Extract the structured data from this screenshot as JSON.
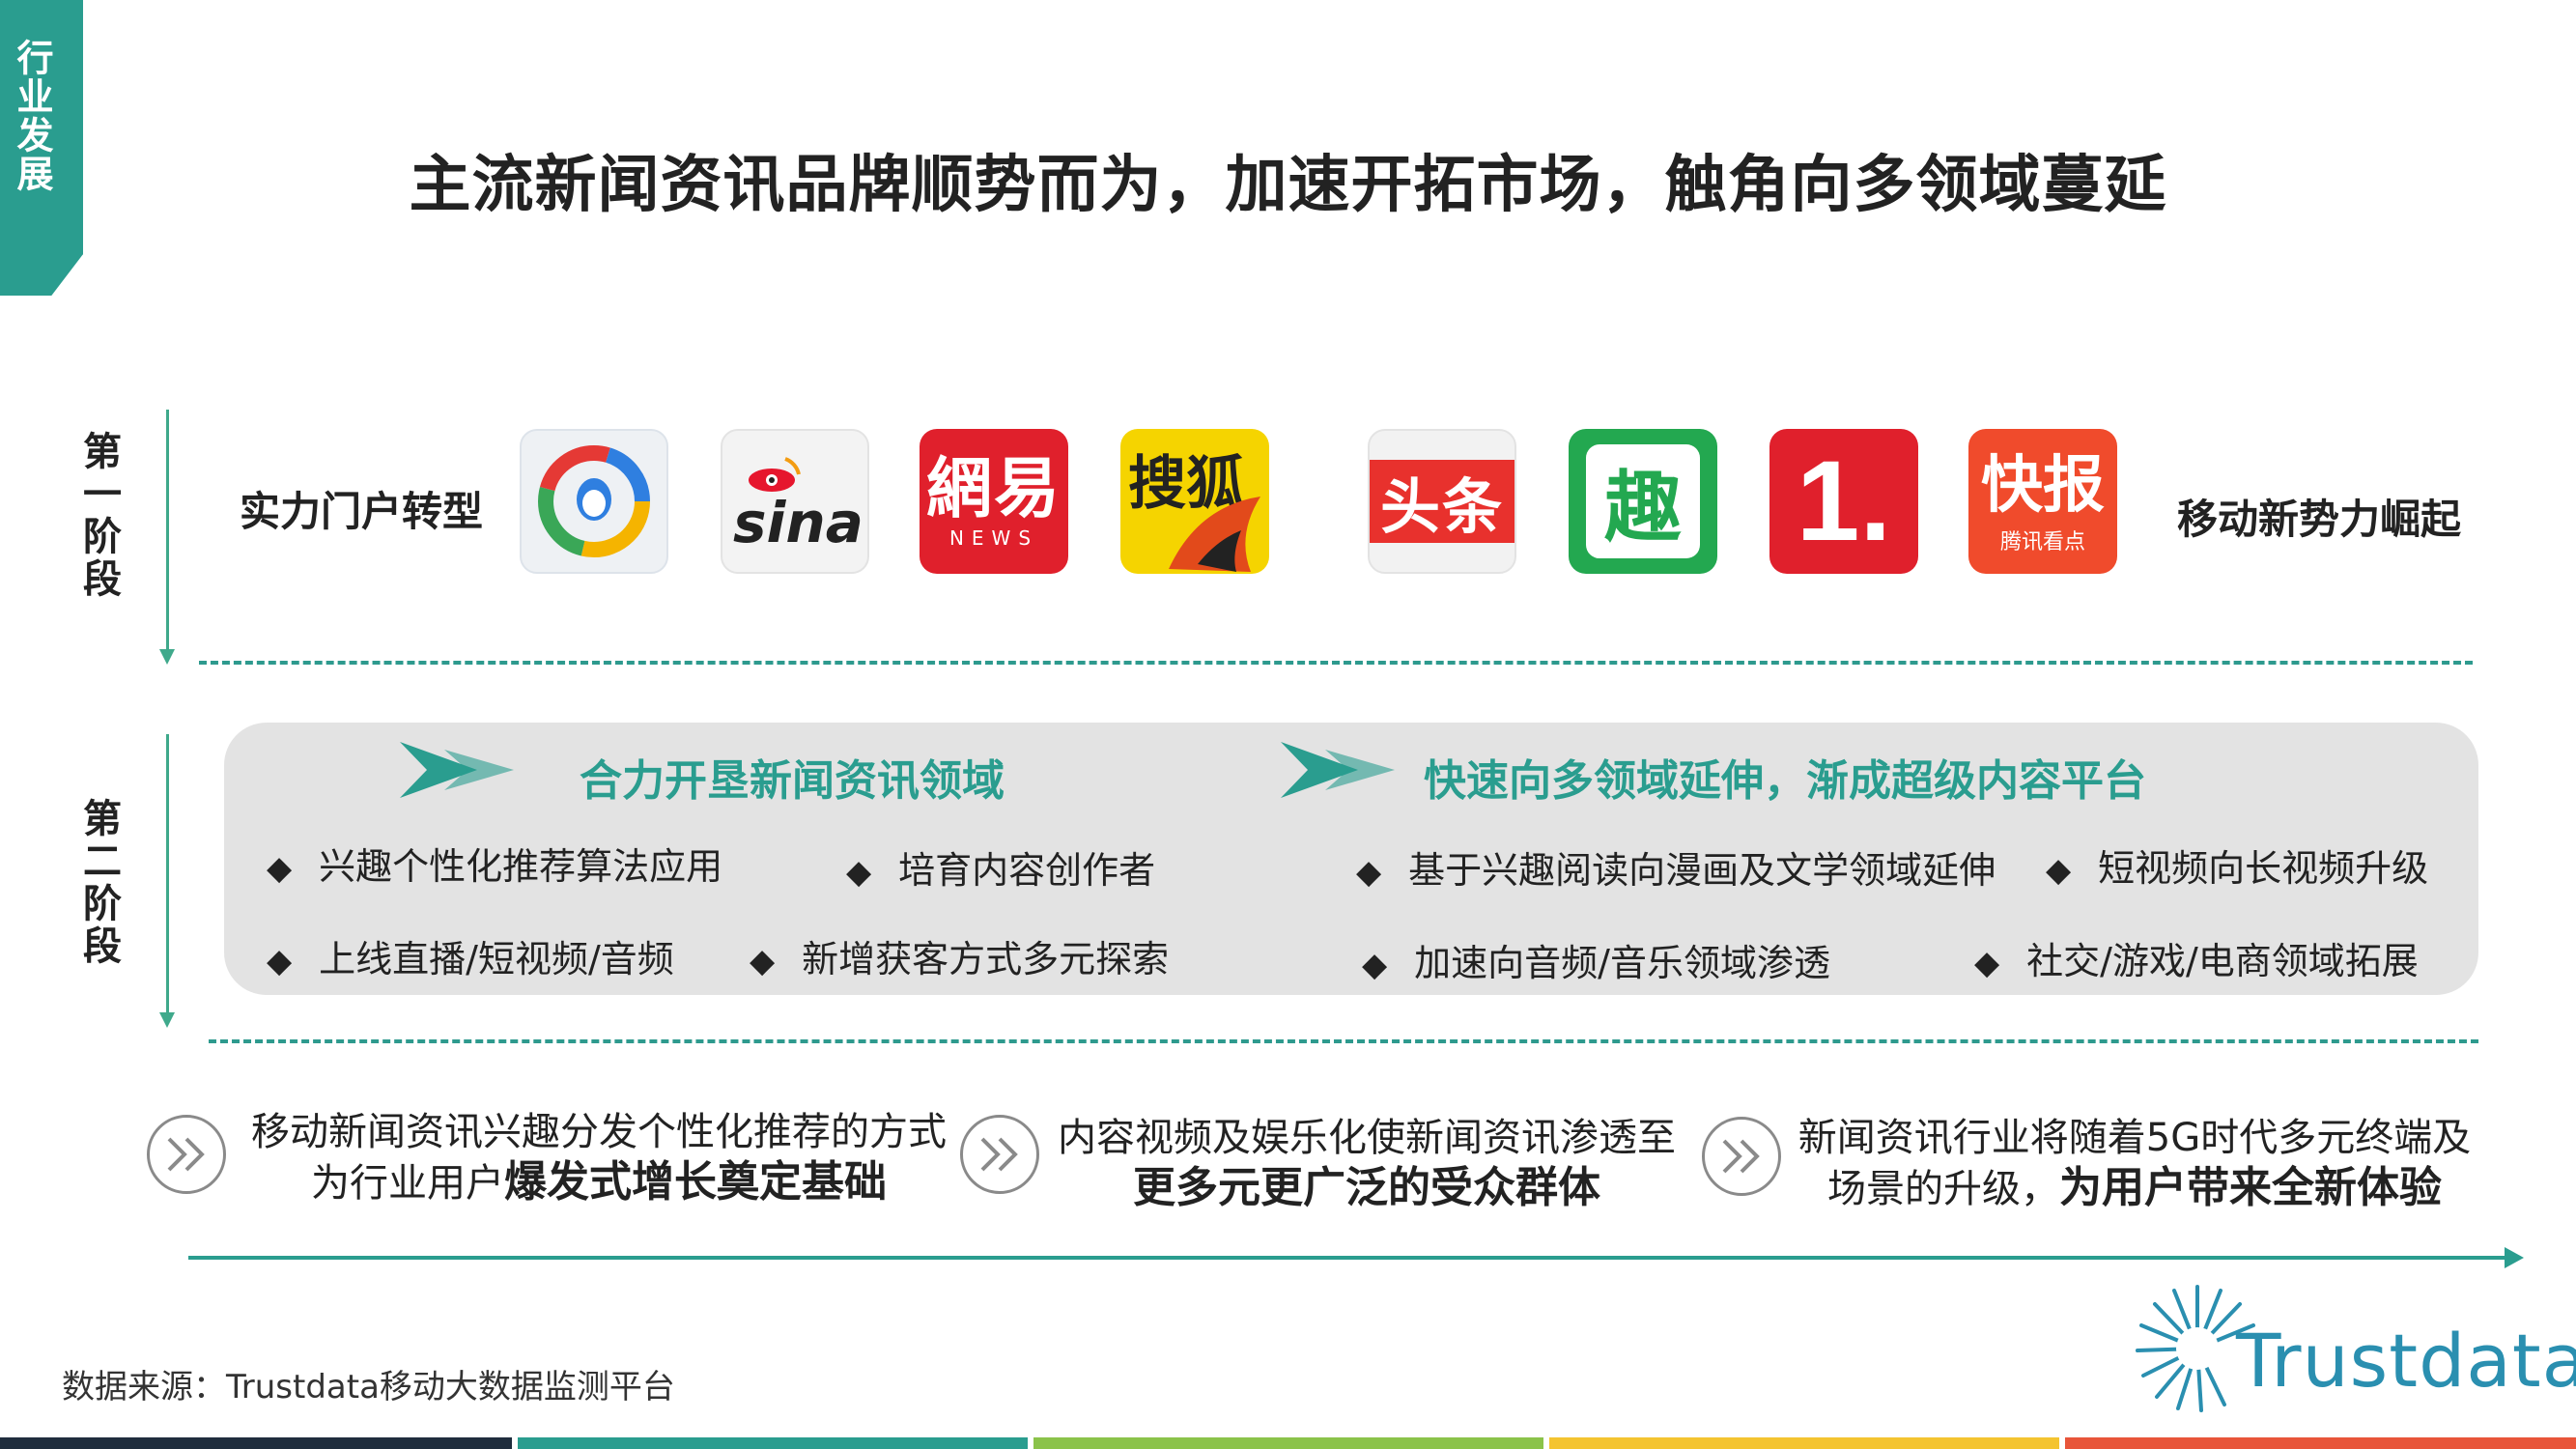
{
  "side_tab": "行业发展",
  "title": "主流新闻资讯品牌顺势而为，加速开拓市场，触角向多领域蔓延",
  "stage1": {
    "label": "第一阶段",
    "left_label": "实力门户转型",
    "right_label": "移动新势力崛起",
    "logos": [
      {
        "name": "tencent-news-logo",
        "text": ""
      },
      {
        "name": "sina-logo",
        "text": "sina"
      },
      {
        "name": "netease-news-logo",
        "text": "網易",
        "sub": "NEWS"
      },
      {
        "name": "sohu-logo",
        "text": "搜狐"
      },
      {
        "name": "toutiao-logo",
        "text": "头条"
      },
      {
        "name": "qutoutiao-logo",
        "text": "趣"
      },
      {
        "name": "yidian-logo",
        "text": "1."
      },
      {
        "name": "kuaibao-logo",
        "text": "快报",
        "sub": "腾讯看点"
      }
    ]
  },
  "stage2": {
    "label": "第二阶段",
    "heading_left": "合力开垦新闻资讯领域",
    "heading_right": "快速向多领域延伸，渐成超级内容平台",
    "bullets": [
      "兴趣个性化推荐算法应用",
      "培育内容创作者",
      "基于兴趣阅读向漫画及文学领域延伸",
      "短视频向长视频升级",
      "上线直播/短视频/音频",
      "新增获客方式多元探索",
      "加速向音频/音乐领域渗透",
      "社交/游戏/电商领域拓展"
    ]
  },
  "summary": [
    {
      "line1": "移动新闻资讯兴趣分发个性化推荐的方式",
      "line2_normal": "为行业用户",
      "line2_bold": "爆发式增长奠定基础"
    },
    {
      "line1": "内容视频及娱乐化使新闻资讯渗透至",
      "line2_normal": "",
      "line2_bold": "更多元更广泛的受众群体"
    },
    {
      "line1": "新闻资讯行业将随着5G时代多元终端及",
      "line2_normal": "场景的升级，",
      "line2_bold": "为用户带来全新体验"
    }
  ],
  "source": "数据来源：Trustdata移动大数据监测平台",
  "brand": "Trustdata",
  "colors": {
    "accent": "#2a9d8f",
    "footer": [
      "#1f2d3d",
      "#2a9d8f",
      "#8bc34a",
      "#f4c430",
      "#e8553a"
    ]
  }
}
